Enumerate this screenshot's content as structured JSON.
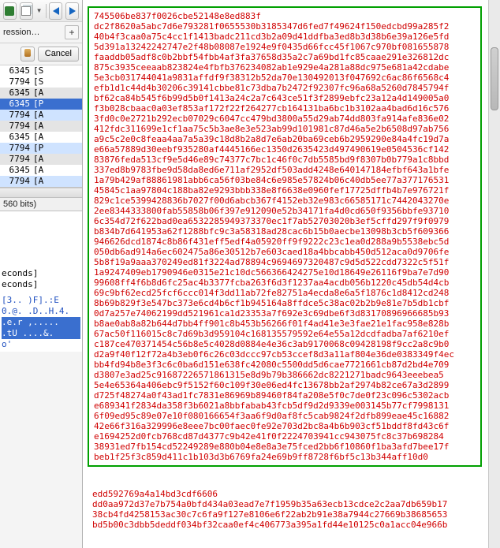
{
  "toolbar": {
    "icons": [
      "save-icon",
      "copy-icon",
      "back-icon",
      "forward-icon"
    ]
  },
  "filter": {
    "label": "ression…",
    "add_label": "+"
  },
  "buttons": {
    "cancel": "Cancel",
    "small_icon": "gold-cyl-icon"
  },
  "packets": [
    {
      "num": "6345",
      "proto": "[S",
      "class": "bg-white"
    },
    {
      "num": "7794",
      "proto": "[S",
      "class": "bg-white"
    },
    {
      "num": "6345",
      "proto": "[A",
      "class": "bg-grey"
    },
    {
      "num": "6345",
      "proto": "[P",
      "class": "bg-sel"
    },
    {
      "num": "7794",
      "proto": "[A",
      "class": "bg-blue"
    },
    {
      "num": "7794",
      "proto": "[A",
      "class": "bg-grey"
    },
    {
      "num": "6345",
      "proto": "[A",
      "class": "bg-white"
    },
    {
      "num": "7794",
      "proto": "[P",
      "class": "bg-blue"
    },
    {
      "num": "7794",
      "proto": "[A",
      "class": "bg-grey"
    },
    {
      "num": "6345",
      "proto": "[A",
      "class": "bg-white"
    },
    {
      "num": "7794",
      "proto": "[A",
      "class": "bg-blue"
    }
  ],
  "status": {
    "bits": "560 bits)"
  },
  "details": {
    "lines": [
      "econds]",
      "econds]"
    ]
  },
  "creds": {
    "lines": [
      {
        "txt": "[3.. )F].:E"
      },
      {
        "txt": "0.@. .D..H.4."
      },
      {
        "txt": ".e.r ,.....",
        "sel": true
      },
      {
        "txt": ".tU ....&.",
        "sel": true
      },
      {
        "txt": "o'"
      }
    ]
  },
  "hex": {
    "boxed": "745506be837f0026cbe52148e8ed883f\ndc2f8620a5abc7d6e793281f0655530b3185347d6fed7f49624f150edcbd99a285f2\n40b4f3caa0a75c4cc1f1413badc211cd3b2a09d41ddfba3ed8b3d38b6e39a126e5fd\n5d391a13242242747e2f48b08087e1924e9f0435d66fcc45f1067c970bf081655878\nfaaddb05adf8c0b2bbf54fbb4af3fa37658d35a2c7a69bd1fc85caae291e326812dc\n875c3935ceeaab823824e4fbfb376234082ab1e929e4a281a88dc975e681a42cdabe\n5e3cb031744041a9831affdf9f38312b52da70e130492013f047692c6ac86f6568c4\nefb1d1c44d4b30206c39141cbbe81c73dba7b2472f92307fc96a68a5260d7845794f\nbf62ca84b545f6b99d5b0f1413a24c2a7c643ce51f3f2899ebfc23a12a4d149005a0\nf3b028cbaac0a03ef853af172f22f264277cb164131ba6bc1b3102aa4bad6d16c576\n3fd0c0e2721b292ecb07029c6047cc479bd3800a55d29ab74dd803fa914afe836e02\n412fdc311699e1cf1aa75c5b3ae8e3e523ab99d101981c87d46a5e2b6508d97ab756\na9c5c2e0c8feaa4aa7a5a39c18d8b2a8d7e6ab20ba69ceb6b2959290e84a4fc19d7a\ne66a57889d30eebf935280af4445166ec1350d2635423d497490619e0504536cf142\n83876feda513cf9e5d46e89c74377c7bc1c46f0c7db5585bd9f8307b0b779a1c8bbd\n337ed8b9783fbe9d58da8ed6e711af2952df503add4248e640147184efbf643a1bfe\n1a79b429af88861981abb6ca56f03be84c6e985e57824b06c40db5ee77a377176531\n45845c1aa97804c188ba82e9293bbb338e8f6638e0960fef17725dffb4b7e976721f\n829c1ce5399428836b7027f00d6abcb367f4152eb32e983c66585171c7442043270e\n2ee8344333800fab55858b06f397e912090e52b34171fa4d0cd650f9356bbfe93710\n6c354d72f622bad0ea6532285949373370ec1f7ab52703020b3ef5cffd297f9f0979\nb834b7d641953a62f1288bfc9c3a58318ad28cac6b15b0aecbe13098b3cb5f609366\n946626dcd1874c8b86f431eff5edf4a05920ff9f9222c23c1ea0d288a9b5538ebc5d\n050db6ad914a6ec602475a86e30512b7e603caed18a4bbcabb450d512aca0d9706fe\n5b8f19a9aaa370249ed81f3224ad78894c9694697320487c9d5d522cdd7322c5f51f\n1a9247409eb1790946e0315e21c10dc566366424275e10d18649e26116f9ba7e7d90\n99608ff4f6b8d6fc25ac4b3377fcba263f6d3f1237aa4acdb056b1220c45db54d4cb\n69c9bf62ecd25fcf6ccc014f3dd11ab72fe82751a4ecda8e6a5f1876c1d8412cd248\n8b69b829f3e547bc373e6cd4b6cf1b945164a8ffdce5c38ac02b2b9e81e7b5db1cbf\n0d7a257e74062199dd521961ca1d23353a7f692e3c69dbe6f3d83170896966685b93\nb8ae0ab8a82b644d7bb4ff901c8b453b56266f01f4ad41e3e3fae21e1fac958e828b\n67ac50f116015c8c7d69b3d959104c168135579592e64e55a12dcdfadba7af6210ef\nc187ce470371454c56b8e5c4028d0884e4e36c3ab9170068c09428198f9cc2a8c9b0\nd2a9f40f12f72a4b3eb0f6c26c03dccc97cb53ccef8d3a11af804e36de0383349f4ec\nbb4fd94b8e3f3c6c0ba6d151e638fc42080c5500dd5d6cae7721661cb87d2bd4e709\nd3807e3ad25c91687226571861315e8d9b79b386662dc8221271badc9643eeebea5\n5e4e65364a406ebc9f5152f60c109f30e06ed4fc13678bb2af2974b82ce67a3d2899\nd725f48274a0f43ad1fc7831e86969b89460f84fa208e5f0c7de0f23c096c5302acb\ne689341f2834da358f3b6021a8bbfabab43fcb5df9d2d9339e003145b77cf7998131\n6f09ed95c89e07e10f080166654f3aa6f9d0af8fc5cab9824f2dfb899eae45c16882\n42e66f316a329996e8eee7bc00faec0fe92e703d2bc8a4b6b903cf51bddf8fd43c6f\ne1694252d0fcb768cd87d4377c9b42e41f0f2224703941cc943075fc8c37b698284\n38931ed7fb154cd52249289e880b04e8e8a3e75fced2bb6f10860f1ba3afd7bee17f\nbeb1f25f3c859d411c1b103d3b6769fa24e69b9ff8728f6bf5c13b344aff10d0",
    "below": "edd592769a4a14bd3cdf6606\ndd0aa972d37e7b754a0bfd434a03ead7e7f1959b35a63ecb13cdce2c2aa7db659b17\n38cb4fd4258153ac30c7c6fa9f127e8106e6f22ab2b91e38a7944c27669b38685653\nbd5b00c3dbb5deddf034bf32caa0ef4c406773a395a1fd44e10125c0a1acc04e966b"
  }
}
